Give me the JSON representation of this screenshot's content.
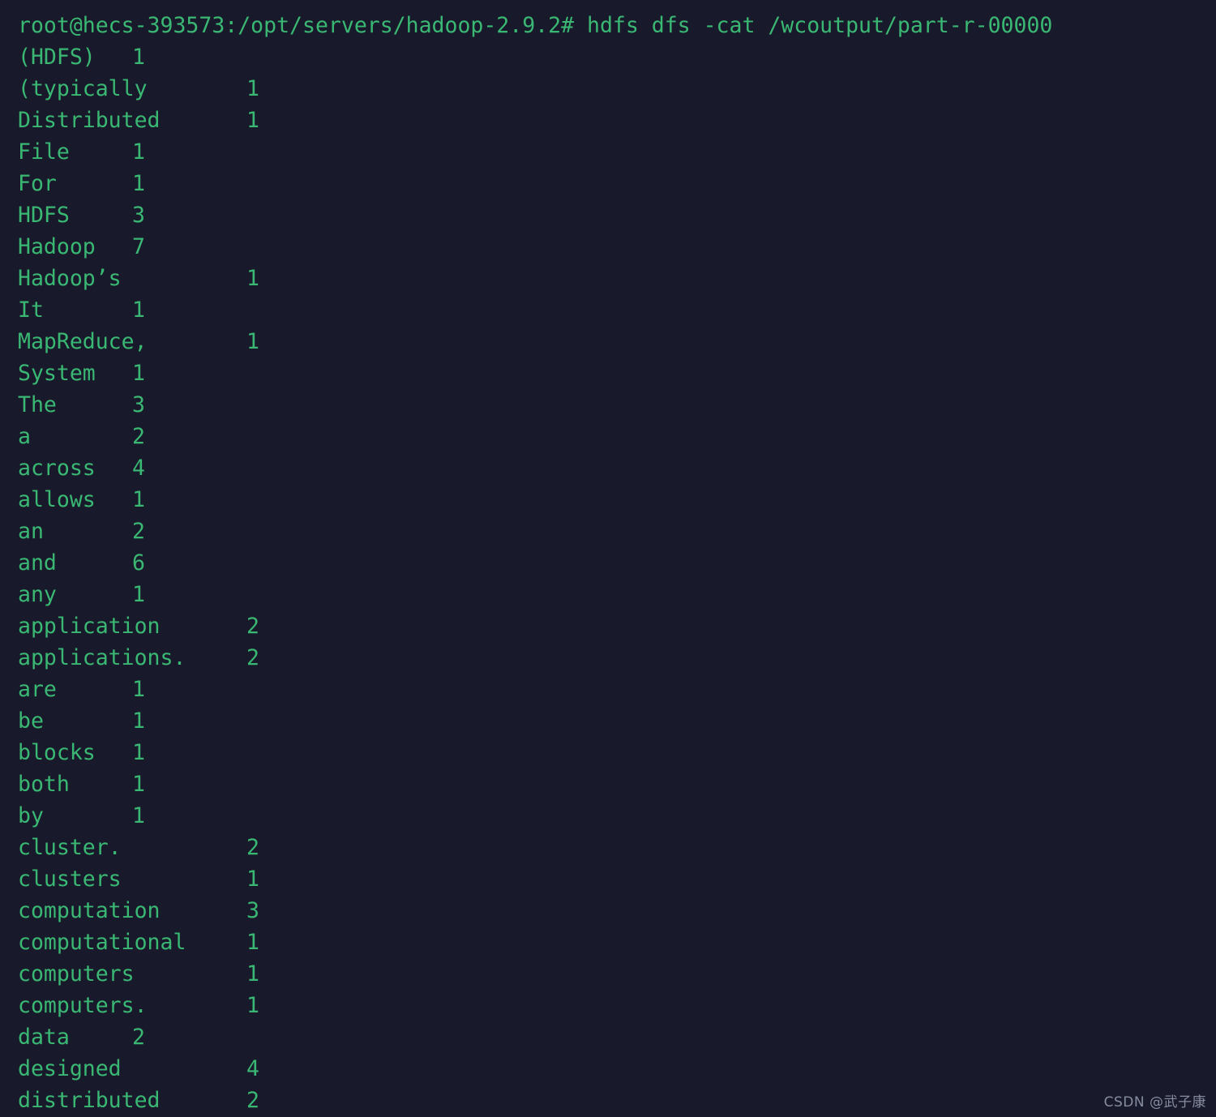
{
  "terminal": {
    "background_color": "#181a2b",
    "text_color": "#3ab873",
    "prompt_line": "root@hecs-393573:/opt/servers/hadoop-2.9.2# hdfs dfs -cat /wcoutput/part-r-00000",
    "user": "root",
    "host": "hecs-393573",
    "cwd": "/opt/servers/hadoop-2.9.2",
    "prompt_symbol": "#",
    "command": "hdfs dfs -cat /wcoutput/part-r-00000"
  },
  "output": {
    "description": "MapReduce word count result: word then TAB then count",
    "rows": [
      {
        "word": "(HDFS)",
        "count": "1",
        "col": "col-8"
      },
      {
        "word": "(typically",
        "count": "1",
        "col": "col-16"
      },
      {
        "word": "Distributed",
        "count": "1",
        "col": "col-16"
      },
      {
        "word": "File",
        "count": "1",
        "col": "col-8"
      },
      {
        "word": "For",
        "count": "1",
        "col": "col-8"
      },
      {
        "word": "HDFS",
        "count": "3",
        "col": "col-8"
      },
      {
        "word": "Hadoop",
        "count": "7",
        "col": "col-8"
      },
      {
        "word": "Hadoop’s",
        "count": "1",
        "col": "col-16"
      },
      {
        "word": "It",
        "count": "1",
        "col": "col-8"
      },
      {
        "word": "MapReduce,",
        "count": "1",
        "col": "col-16"
      },
      {
        "word": "System",
        "count": "1",
        "col": "col-8"
      },
      {
        "word": "The",
        "count": "3",
        "col": "col-8"
      },
      {
        "word": "a",
        "count": "2",
        "col": "col-8"
      },
      {
        "word": "across",
        "count": "4",
        "col": "col-8"
      },
      {
        "word": "allows",
        "count": "1",
        "col": "col-8"
      },
      {
        "word": "an",
        "count": "2",
        "col": "col-8"
      },
      {
        "word": "and",
        "count": "6",
        "col": "col-8"
      },
      {
        "word": "any",
        "count": "1",
        "col": "col-8"
      },
      {
        "word": "application",
        "count": "2",
        "col": "col-16"
      },
      {
        "word": "applications.",
        "count": "2",
        "col": "col-16"
      },
      {
        "word": "are",
        "count": "1",
        "col": "col-8"
      },
      {
        "word": "be",
        "count": "1",
        "col": "col-8"
      },
      {
        "word": "blocks",
        "count": "1",
        "col": "col-8"
      },
      {
        "word": "both",
        "count": "1",
        "col": "col-8"
      },
      {
        "word": "by",
        "count": "1",
        "col": "col-8"
      },
      {
        "word": "cluster.",
        "count": "2",
        "col": "col-16"
      },
      {
        "word": "clusters",
        "count": "1",
        "col": "col-16"
      },
      {
        "word": "computation",
        "count": "3",
        "col": "col-16"
      },
      {
        "word": "computational",
        "count": "1",
        "col": "col-16"
      },
      {
        "word": "computers",
        "count": "1",
        "col": "col-16"
      },
      {
        "word": "computers.",
        "count": "1",
        "col": "col-16"
      },
      {
        "word": "data",
        "count": "2",
        "col": "col-8"
      },
      {
        "word": "designed",
        "count": "4",
        "col": "col-16"
      },
      {
        "word": "distributed",
        "count": "2",
        "col": "col-16"
      }
    ]
  },
  "watermark": {
    "text": "CSDN @武子康"
  }
}
